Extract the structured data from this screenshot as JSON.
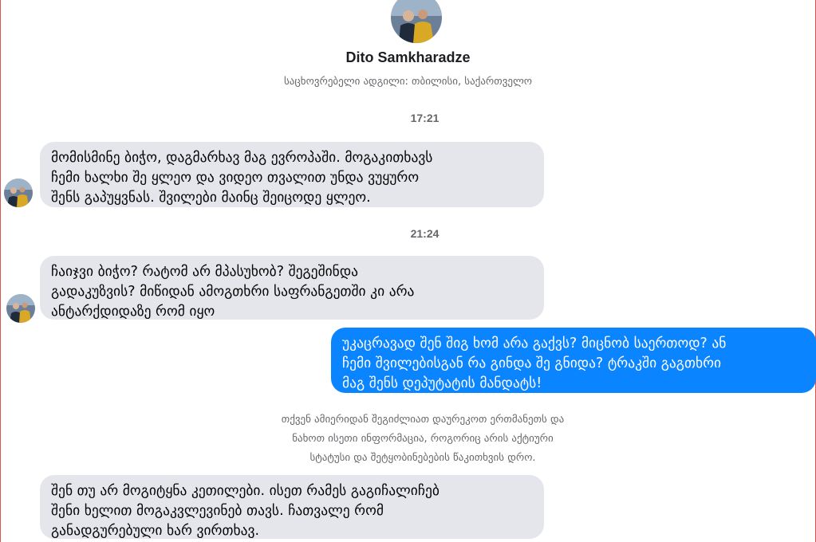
{
  "profile": {
    "name": "Dito Samkharadze",
    "location": "საცხოვრებელი ადგილი: თბილისი, საქართველო"
  },
  "conversation": {
    "time_1": "17:21",
    "message_1": "მომისმინე ბიჭო, დაგმარხავ მაგ ევროპაში. მოგაკითხავს\nჩემი ხალხი შე ყლეო და ვიდეო თვალით უნდა ვუყურო\nშენს გაპუყვნას. შვილები მაინც შეიცოდე ყლეო.",
    "time_2": "21:24",
    "message_2": "ჩაიჯვი ბიჭო? რატომ არ მპასუხობ?  შეგეშინდა\nგადაკუზვის? მიწიდან ამოგთხრი საფრანგეთში კი არა\nანტარქდიდაზე რომ იყო",
    "message_3_outgoing": "უკაცრავად შენ შიგ ხომ არა გაქვს?  მიცნობ საერთოდ? ან\nჩემი შვილებისგან რა გინდა შე გნიდა? ტრაკში გაგთხრი\nმაგ შენს დეპუტატის მანდატს!",
    "notice": "თქვენ ამიერიდან შეგიძლიათ დაურეკოთ ერთმანეთს და\nნახოთ ისეთი ინფორმაცია, როგორიც არის აქტიური\nსტატუსი და შეტყობინებების წაკითხვის დრო.",
    "message_4": "შენ თუ არ მოგიტყნა კეთილები. ისეთ რამეს გაგიჩალიჩებ\nშენი ხელით მოგაკვლევინებ თავს. ჩათვალე რომ\nგანადგურებული ხარ ვირთხავ."
  },
  "colors": {
    "incoming_bubble": "#e4e6eb",
    "outgoing_bubble": "#0a84ff",
    "meta_text": "#65676b",
    "frame": "#d9534f"
  }
}
